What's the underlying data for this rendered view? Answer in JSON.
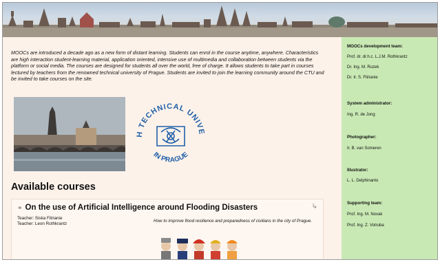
{
  "intro_text": "MOOCs are introduced a decade ago as a new form of distant learning. Students can enrol in the course anytime, anywhere. Characteristics are high interaction student-learning material, application oriented, intensive use of multimedia and collaboration between students via the platform or social media. The courses are designed for students all over the world, free of charge. It allows students to take part in courses lectured by teachers from the renowned technical university of Prague. Students are invited to join the learning community around the CTU and be invited to take courses on the site.",
  "logo": {
    "text_top": "CZECH TECHNICAL UNIVERSITY",
    "text_bottom": "IN PRAGUE",
    "color": "#1f5fa8"
  },
  "available_heading": "Available courses",
  "course": {
    "title": "On the use of Artificial Intelligence around Flooding Disasters",
    "teachers": [
      "Teacher: Siska Fitrianie",
      "Teacher: Leon Rothkrantz"
    ],
    "summary": "How to improve flood resilience and preparedness of civilians in the city of Prague.",
    "icon": "course-icon",
    "enrol_icon": "enrol-icon"
  },
  "sidebar": {
    "sections": [
      {
        "title": "MOOCs development team:",
        "items": [
          "Prof. dr. dr.h.c. L.J.M. Rothkrantz",
          "Dr. Ing. M. Ruzek",
          "Dr. Ir. S. Fitrianie"
        ]
      },
      {
        "title": "System administrator:",
        "items": [
          "Ing. R. de Jong"
        ]
      },
      {
        "title": "Photographer:",
        "items": [
          "Ir. B. van Someren"
        ]
      },
      {
        "title": "Illustrator:",
        "items": [
          "L. L. Delphinanto"
        ]
      },
      {
        "title": "Supporting team:",
        "items": [
          "Prof. Ing. M. Novak",
          "Prof. Ing. Z. Votruba"
        ]
      }
    ],
    "accent": "#c9e9b4"
  }
}
